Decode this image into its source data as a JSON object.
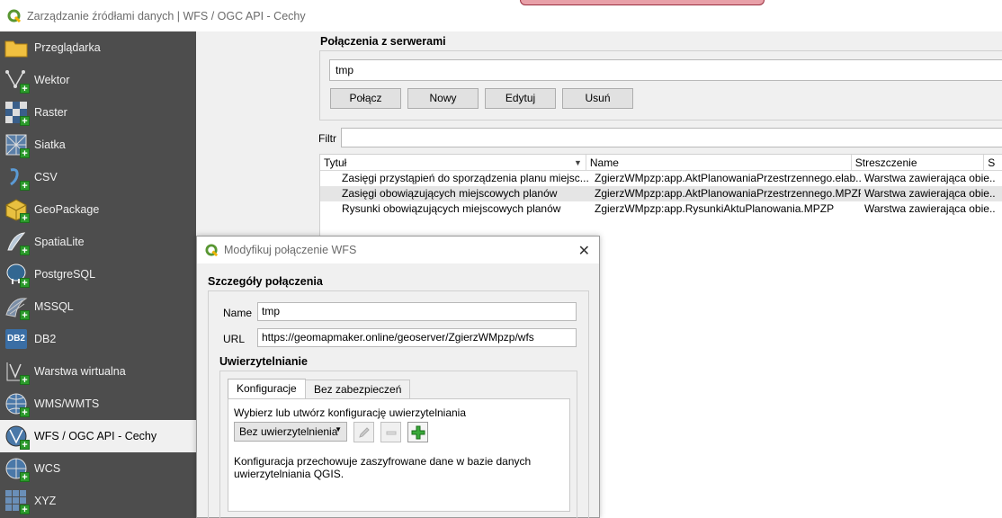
{
  "window": {
    "title": "Zarządzanie źródłami danych | WFS / OGC API - Cechy"
  },
  "sidebar": {
    "items": [
      {
        "label": "Przeglądarka",
        "icon": "folder-icon"
      },
      {
        "label": "Wektor",
        "icon": "vector-icon"
      },
      {
        "label": "Raster",
        "icon": "raster-icon"
      },
      {
        "label": "Siatka",
        "icon": "mesh-icon"
      },
      {
        "label": "CSV",
        "icon": "csv-icon"
      },
      {
        "label": "GeoPackage",
        "icon": "geopackage-icon"
      },
      {
        "label": "SpatiaLite",
        "icon": "spatialite-icon"
      },
      {
        "label": "PostgreSQL",
        "icon": "postgresql-icon"
      },
      {
        "label": "MSSQL",
        "icon": "mssql-icon"
      },
      {
        "label": "DB2",
        "icon": "db2-icon"
      },
      {
        "label": "Warstwa wirtualna",
        "icon": "virtual-layer-icon"
      },
      {
        "label": "WMS/WMTS",
        "icon": "wms-icon"
      },
      {
        "label": "WFS / OGC API - Cechy",
        "icon": "wfs-icon"
      },
      {
        "label": "WCS",
        "icon": "wcs-icon"
      },
      {
        "label": "XYZ",
        "icon": "xyz-icon"
      }
    ],
    "active_index": 12,
    "db2_badge": "DB2"
  },
  "connections": {
    "header": "Połączenia z serwerami",
    "selected": "tmp",
    "buttons": {
      "connect": "Połącz",
      "new": "Nowy",
      "edit": "Edytuj",
      "remove": "Usuń"
    }
  },
  "filter": {
    "label": "Filtr",
    "value": ""
  },
  "table": {
    "columns": [
      "Tytuł",
      "Name",
      "Streszczenie",
      "S"
    ],
    "rows": [
      {
        "title": "Zasięgi przystąpień do sporządzenia planu miejsc...",
        "name": "ZgierzWMpzp:app.AktPlanowaniaPrzestrzennego.elab...",
        "abstract": "Warstwa zawierająca obie...",
        "selected": false
      },
      {
        "title": "Zasięgi  obowiązujących  miejscowych planów",
        "name": "ZgierzWMpzp:app.AktPlanowaniaPrzestrzennego.MPZP",
        "abstract": "Warstwa zawierająca obie...",
        "selected": true
      },
      {
        "title": "Rysunki  obowiązujących  miejscowych planów",
        "name": "ZgierzWMpzp:app.RysunkiAktuPlanowania.MPZP",
        "abstract": "Warstwa zawierająca obie...",
        "selected": false
      }
    ]
  },
  "dialog": {
    "title": "Modyfikuj połączenie WFS",
    "group_title": "Szczegóły połączenia",
    "name_label": "Name",
    "name_value": "tmp",
    "url_label": "URL",
    "url_value": "https://geomapmaker.online/geoserver/ZgierzWMpzp/wfs",
    "auth_title": "Uwierzytelnianie",
    "tabs": [
      "Konfiguracje",
      "Bez zabezpieczeń"
    ],
    "active_tab": 0,
    "choose_label": "Wybierz lub utwórz konfigurację uwierzytelniania",
    "auth_combo": "Bez uwierzytelnienia",
    "info_text_1": "Konfiguracja przechowuje zaszyfrowane dane w bazie danych",
    "info_text_2": "uwierzytelniania QGIS."
  },
  "colors": {
    "sidebar_bg": "#4d4d4d",
    "qgis_green": "#589632",
    "plus_green": "#2b9a2b"
  }
}
